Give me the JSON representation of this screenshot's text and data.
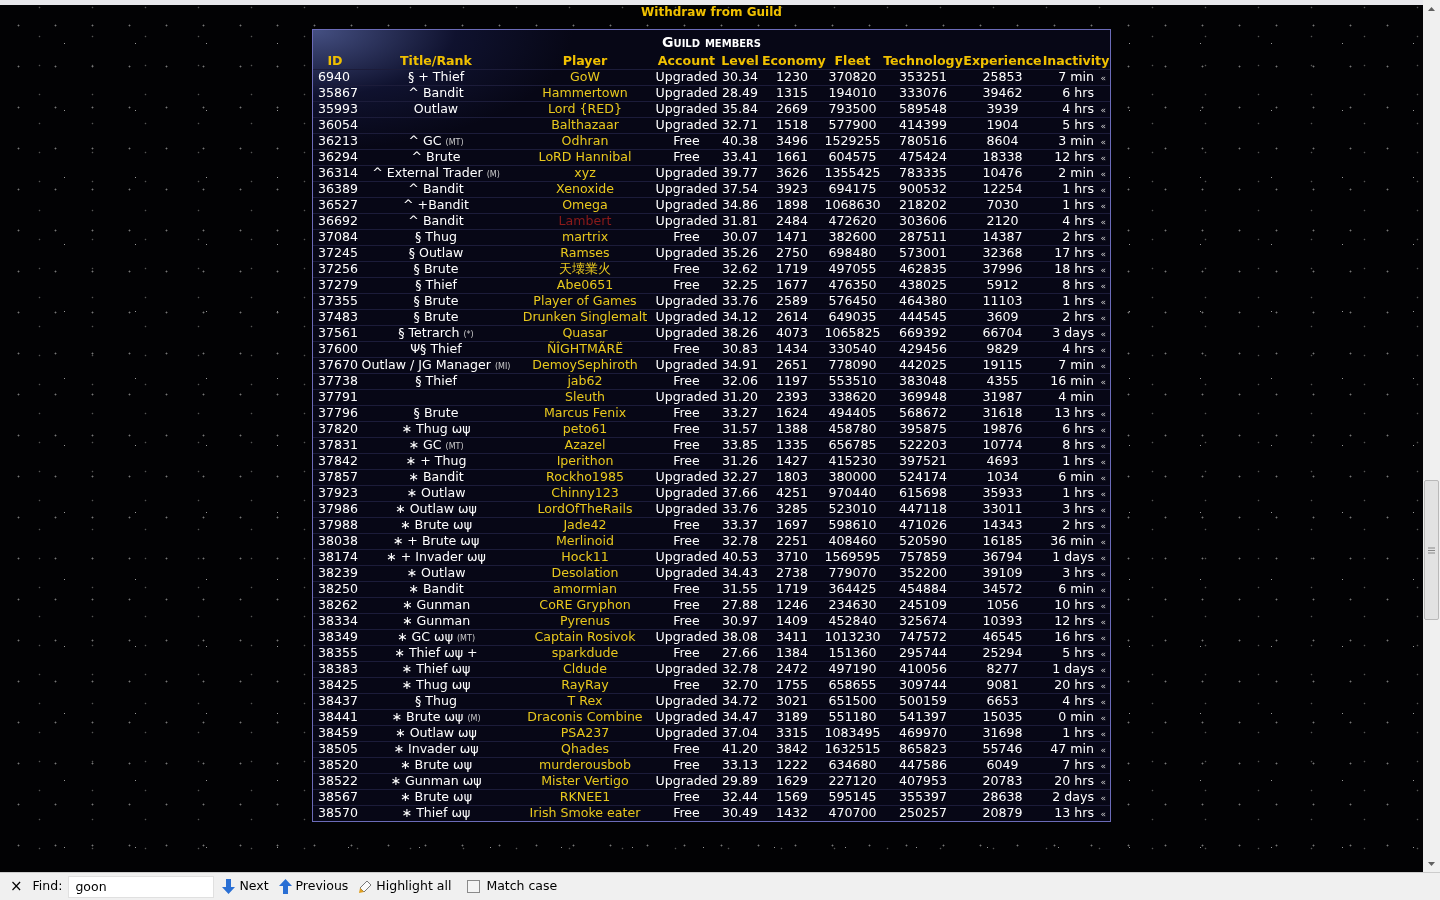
{
  "header_link": "Withdraw from Guild",
  "table": {
    "title": "Guild members",
    "columns": [
      "ID",
      "Title/Rank",
      "Player",
      "Account",
      "Level",
      "Economy",
      "Fleet",
      "Technology",
      "Experience",
      "Inactivity"
    ],
    "rows": [
      {
        "id": "6940",
        "rank": "§ + Thief",
        "player": "GoW",
        "color": "#e8c81e",
        "account": "Upgraded",
        "level": "30.34",
        "economy": "1230",
        "fleet": "370820",
        "technology": "353251",
        "experience": "25853",
        "inactivity": "7 min",
        "mark": "«"
      },
      {
        "id": "35867",
        "rank": "^ Bandit",
        "player": "Hammertown",
        "color": "#e8c81e",
        "account": "Upgraded",
        "level": "28.49",
        "economy": "1315",
        "fleet": "194010",
        "technology": "333076",
        "experience": "39462",
        "inactivity": "6 hrs"
      },
      {
        "id": "35993",
        "rank": "Outlaw",
        "player": "Lord {RED}",
        "color": "#e8c81e",
        "account": "Upgraded",
        "level": "35.84",
        "economy": "2669",
        "fleet": "793500",
        "technology": "589548",
        "experience": "3939",
        "inactivity": "4 hrs",
        "mark": "«"
      },
      {
        "id": "36054",
        "player": "Balthazaar",
        "color": "#e8c81e",
        "account": "Upgraded",
        "level": "32.71",
        "economy": "1518",
        "fleet": "577900",
        "technology": "414399",
        "experience": "1904",
        "inactivity": "5 hrs",
        "mark": "«"
      },
      {
        "id": "36213",
        "rank": "^ GC",
        "tag": "(MT)",
        "player": "Odhran",
        "color": "#e8c81e",
        "account": "Free",
        "level": "40.38",
        "economy": "3496",
        "fleet": "1529255",
        "technology": "780516",
        "experience": "8604",
        "inactivity": "3 min",
        "mark": "«"
      },
      {
        "id": "36294",
        "rank": "^ Brute",
        "player": "LoRD Hannibal",
        "color": "#e8c81e",
        "account": "Free",
        "level": "33.41",
        "economy": "1661",
        "fleet": "604575",
        "technology": "475424",
        "experience": "18338",
        "inactivity": "12 hrs",
        "mark": "«"
      },
      {
        "id": "36314",
        "rank": "^ External Trader",
        "tag": "(M)",
        "player": "xyz",
        "color": "#e8c81e",
        "account": "Upgraded",
        "level": "39.77",
        "economy": "3626",
        "fleet": "1355425",
        "technology": "783335",
        "experience": "10476",
        "inactivity": "2 min",
        "mark": "«"
      },
      {
        "id": "36389",
        "rank": "^ Bandit",
        "player": "Xenoxide",
        "color": "#e8c81e",
        "account": "Upgraded",
        "level": "37.54",
        "economy": "3923",
        "fleet": "694175",
        "technology": "900532",
        "experience": "12254",
        "inactivity": "1 hrs",
        "mark": "«"
      },
      {
        "id": "36527",
        "rank": "^ +Bandit",
        "player": "Omega",
        "color": "#e8c81e",
        "account": "Upgraded",
        "level": "34.86",
        "economy": "1898",
        "fleet": "1068630",
        "technology": "218202",
        "experience": "7030",
        "inactivity": "1 hrs",
        "mark": "«"
      },
      {
        "id": "36692",
        "rank": "^ Bandit",
        "player": "Lambert",
        "color": "#8b1a1a",
        "account": "Upgraded",
        "level": "31.81",
        "economy": "2484",
        "fleet": "472620",
        "technology": "303606",
        "experience": "2120",
        "inactivity": "4 hrs",
        "mark": "«"
      },
      {
        "id": "37084",
        "rank": "§ Thug",
        "player": "martrix",
        "color": "#e8c81e",
        "account": "Free",
        "level": "30.07",
        "economy": "1471",
        "fleet": "382600",
        "technology": "287511",
        "experience": "14387",
        "inactivity": "2 hrs",
        "mark": "«"
      },
      {
        "id": "37245",
        "rank": "§ Outlaw",
        "player": "Ramses",
        "color": "#e8c81e",
        "account": "Upgraded",
        "level": "35.26",
        "economy": "2750",
        "fleet": "698480",
        "technology": "573001",
        "experience": "32368",
        "inactivity": "17 hrs",
        "mark": "«"
      },
      {
        "id": "37256",
        "rank": "§ Brute",
        "player": "天壊業火",
        "color": "#e8c81e",
        "account": "Free",
        "level": "32.62",
        "economy": "1719",
        "fleet": "497055",
        "technology": "462835",
        "experience": "37996",
        "inactivity": "18 hrs",
        "mark": "«"
      },
      {
        "id": "37279",
        "rank": "§ Thief",
        "player": "Abe0651",
        "color": "#e8c81e",
        "account": "Free",
        "level": "32.25",
        "economy": "1677",
        "fleet": "476350",
        "technology": "438025",
        "experience": "5912",
        "inactivity": "8 hrs",
        "mark": "«"
      },
      {
        "id": "37355",
        "rank": "§ Brute",
        "player": "Player of Games",
        "color": "#e8c81e",
        "account": "Upgraded",
        "level": "33.76",
        "economy": "2589",
        "fleet": "576450",
        "technology": "464380",
        "experience": "11103",
        "inactivity": "1 hrs",
        "mark": "«"
      },
      {
        "id": "37483",
        "rank": "§ Brute",
        "player": "Drunken Singlemalt",
        "color": "#e8c81e",
        "account": "Upgraded",
        "level": "34.12",
        "economy": "2614",
        "fleet": "649035",
        "technology": "444545",
        "experience": "3609",
        "inactivity": "2 hrs",
        "mark": "«"
      },
      {
        "id": "37561",
        "rank": "§ Tetrarch",
        "tag": "(*)",
        "player": "Quasar",
        "color": "#e8c81e",
        "account": "Upgraded",
        "level": "38.26",
        "economy": "4073",
        "fleet": "1065825",
        "technology": "669392",
        "experience": "66704",
        "inactivity": "3 days",
        "mark": "«"
      },
      {
        "id": "37600",
        "rank": "Ψ§ Thief",
        "player": "ÑÎGHTMÃRË",
        "color": "#e8c81e",
        "account": "Free",
        "level": "30.83",
        "economy": "1434",
        "fleet": "330540",
        "technology": "429456",
        "experience": "9829",
        "inactivity": "4 hrs",
        "mark": "«"
      },
      {
        "id": "37670",
        "rank": "Outlaw / JG Manager",
        "tag": "(MI)",
        "player": "DemoySephiroth",
        "color": "#e8c81e",
        "account": "Upgraded",
        "level": "34.91",
        "economy": "2651",
        "fleet": "778090",
        "technology": "442025",
        "experience": "19115",
        "inactivity": "7 min",
        "mark": "«"
      },
      {
        "id": "37738",
        "rank": "§ Thief",
        "player": "jab62",
        "color": "#e8c81e",
        "account": "Free",
        "level": "32.06",
        "economy": "1197",
        "fleet": "553510",
        "technology": "383048",
        "experience": "4355",
        "inactivity": "16 min",
        "mark": "«"
      },
      {
        "id": "37791",
        "player": "Sleuth",
        "color": "#e8c81e",
        "account": "Upgraded",
        "level": "31.20",
        "economy": "2393",
        "fleet": "338620",
        "technology": "369948",
        "experience": "31987",
        "inactivity": "4 min"
      },
      {
        "id": "37796",
        "rank": "§ Brute",
        "player": "Marcus Fenix",
        "color": "#e8c81e",
        "account": "Free",
        "level": "33.27",
        "economy": "1624",
        "fleet": "494405",
        "technology": "568672",
        "experience": "31618",
        "inactivity": "13 hrs",
        "mark": "«"
      },
      {
        "id": "37820",
        "rank": "∗ Thug ωψ",
        "player": "peto61",
        "color": "#e8c81e",
        "account": "Free",
        "level": "31.57",
        "economy": "1388",
        "fleet": "458780",
        "technology": "395875",
        "experience": "19876",
        "inactivity": "6 hrs",
        "mark": "«"
      },
      {
        "id": "37831",
        "rank": "∗ GC",
        "tag": "(MT)",
        "player": "Azazel",
        "color": "#e8c81e",
        "account": "Free",
        "level": "33.85",
        "economy": "1335",
        "fleet": "656785",
        "technology": "522203",
        "experience": "10774",
        "inactivity": "8 hrs",
        "mark": "«"
      },
      {
        "id": "37842",
        "rank": "∗ + Thug",
        "player": "Iperithon",
        "color": "#e8c81e",
        "account": "Free",
        "level": "31.26",
        "economy": "1427",
        "fleet": "415230",
        "technology": "397521",
        "experience": "4693",
        "inactivity": "1 hrs",
        "mark": "«"
      },
      {
        "id": "37857",
        "rank": "∗ Bandit",
        "player": "Rockho1985",
        "color": "#e8c81e",
        "account": "Upgraded",
        "level": "32.27",
        "economy": "1803",
        "fleet": "380000",
        "technology": "524174",
        "experience": "1034",
        "inactivity": "6 min",
        "mark": "«"
      },
      {
        "id": "37923",
        "rank": "∗ Outlaw",
        "player": "Chinny123",
        "color": "#e8c81e",
        "account": "Upgraded",
        "level": "37.66",
        "economy": "4251",
        "fleet": "970440",
        "technology": "615698",
        "experience": "35933",
        "inactivity": "1 hrs",
        "mark": "«"
      },
      {
        "id": "37986",
        "rank": "∗ Outlaw ωψ",
        "player": "LordOfTheRails",
        "color": "#e8c81e",
        "account": "Upgraded",
        "level": "33.76",
        "economy": "3285",
        "fleet": "523010",
        "technology": "447118",
        "experience": "33011",
        "inactivity": "3 hrs",
        "mark": "«"
      },
      {
        "id": "37988",
        "rank": "∗ Brute ωψ",
        "player": "Jade42",
        "color": "#e8c81e",
        "account": "Free",
        "level": "33.37",
        "economy": "1697",
        "fleet": "598610",
        "technology": "471026",
        "experience": "14343",
        "inactivity": "2 hrs",
        "mark": "«"
      },
      {
        "id": "38038",
        "rank": "∗ + Brute ωψ",
        "player": "Merlinoid",
        "color": "#e8c81e",
        "account": "Free",
        "level": "32.78",
        "economy": "2251",
        "fleet": "408460",
        "technology": "520590",
        "experience": "16185",
        "inactivity": "36 min",
        "mark": "«"
      },
      {
        "id": "38174",
        "rank": "∗ + Invader ωψ",
        "player": "Hock11",
        "color": "#e8c81e",
        "account": "Upgraded",
        "level": "40.53",
        "economy": "3710",
        "fleet": "1569595",
        "technology": "757859",
        "experience": "36794",
        "inactivity": "1 days",
        "mark": "«"
      },
      {
        "id": "38239",
        "rank": "∗ Outlaw",
        "player": "Desolation",
        "color": "#e8c81e",
        "account": "Upgraded",
        "level": "34.43",
        "economy": "2738",
        "fleet": "779070",
        "technology": "352200",
        "experience": "39109",
        "inactivity": "3 hrs",
        "mark": "«"
      },
      {
        "id": "38250",
        "rank": "∗ Bandit",
        "player": "amormian",
        "color": "#e8c81e",
        "account": "Free",
        "level": "31.55",
        "economy": "1719",
        "fleet": "364425",
        "technology": "454884",
        "experience": "34572",
        "inactivity": "6 min",
        "mark": "«"
      },
      {
        "id": "38262",
        "rank": "∗ Gunman",
        "player": "CoRE Gryphon",
        "color": "#e8c81e",
        "account": "Free",
        "level": "27.88",
        "economy": "1246",
        "fleet": "234630",
        "technology": "245109",
        "experience": "1056",
        "inactivity": "10 hrs",
        "mark": "«"
      },
      {
        "id": "38334",
        "rank": "∗ Gunman",
        "player": "Pyrenus",
        "color": "#e8c81e",
        "account": "Free",
        "level": "30.97",
        "economy": "1409",
        "fleet": "452840",
        "technology": "325674",
        "experience": "10393",
        "inactivity": "12 hrs",
        "mark": "«"
      },
      {
        "id": "38349",
        "rank": "∗ GC ωψ",
        "tag": "(MT)",
        "player": "Captain Rosivok",
        "color": "#e8c81e",
        "account": "Upgraded",
        "level": "38.08",
        "economy": "3411",
        "fleet": "1013230",
        "technology": "747572",
        "experience": "46545",
        "inactivity": "16 hrs",
        "mark": "«"
      },
      {
        "id": "38355",
        "rank": "∗ Thief ωψ +",
        "player": "sparkdude",
        "color": "#e8c81e",
        "account": "Free",
        "level": "27.66",
        "economy": "1384",
        "fleet": "151360",
        "technology": "295744",
        "experience": "25294",
        "inactivity": "5 hrs",
        "mark": "«"
      },
      {
        "id": "38383",
        "rank": "∗ Thief ωψ",
        "player": "Cldude",
        "color": "#e8c81e",
        "account": "Upgraded",
        "level": "32.78",
        "economy": "2472",
        "fleet": "497190",
        "technology": "410056",
        "experience": "8277",
        "inactivity": "1 days",
        "mark": "«"
      },
      {
        "id": "38425",
        "rank": "∗ Thug ωψ",
        "player": "RayRay",
        "color": "#e8c81e",
        "account": "Free",
        "level": "32.70",
        "economy": "1755",
        "fleet": "658655",
        "technology": "309744",
        "experience": "9081",
        "inactivity": "20 hrs",
        "mark": "«"
      },
      {
        "id": "38437",
        "rank": "§ Thug",
        "player": "T Rex",
        "color": "#e8c81e",
        "account": "Upgraded",
        "level": "34.72",
        "economy": "3021",
        "fleet": "651500",
        "technology": "500159",
        "experience": "6653",
        "inactivity": "4 hrs",
        "mark": "«"
      },
      {
        "id": "38441",
        "rank": "∗ Brute ωψ",
        "tag": "(M)",
        "player": "Draconis Combine",
        "color": "#e8c81e",
        "account": "Upgraded",
        "level": "34.47",
        "economy": "3189",
        "fleet": "551180",
        "technology": "541397",
        "experience": "15035",
        "inactivity": "0 min",
        "mark": "«"
      },
      {
        "id": "38459",
        "rank": "∗ Outlaw ωψ",
        "player": "PSA237",
        "color": "#e8c81e",
        "account": "Upgraded",
        "level": "37.04",
        "economy": "3315",
        "fleet": "1083495",
        "technology": "469970",
        "experience": "31698",
        "inactivity": "1 hrs",
        "mark": "«"
      },
      {
        "id": "38505",
        "rank": "∗ Invader ωψ",
        "player": "Qhades",
        "color": "#e8c81e",
        "account": "Free",
        "level": "41.20",
        "economy": "3842",
        "fleet": "1632515",
        "technology": "865823",
        "experience": "55746",
        "inactivity": "47 min",
        "mark": "«"
      },
      {
        "id": "38520",
        "rank": "∗ Brute ωψ",
        "player": "murderousbob",
        "color": "#e8c81e",
        "account": "Free",
        "level": "33.13",
        "economy": "1222",
        "fleet": "634680",
        "technology": "447586",
        "experience": "6049",
        "inactivity": "7 hrs",
        "mark": "«"
      },
      {
        "id": "38522",
        "rank": "∗ Gunman ωψ",
        "player": "Mister Vertigo",
        "color": "#e8c81e",
        "account": "Upgraded",
        "level": "29.89",
        "economy": "1629",
        "fleet": "227120",
        "technology": "407953",
        "experience": "20783",
        "inactivity": "20 hrs",
        "mark": "«"
      },
      {
        "id": "38567",
        "rank": "∗ Brute ωψ",
        "player": "RKNEE1",
        "color": "#e8c81e",
        "account": "Free",
        "level": "32.44",
        "economy": "1569",
        "fleet": "595145",
        "technology": "355397",
        "experience": "28638",
        "inactivity": "2 days",
        "mark": "«"
      },
      {
        "id": "38570",
        "rank": "∗ Thief ωψ",
        "player": "Irish Smoke eater",
        "color": "#e8c81e",
        "account": "Free",
        "level": "30.49",
        "economy": "1432",
        "fleet": "470700",
        "technology": "250257",
        "experience": "20879",
        "inactivity": "13 hrs",
        "mark": "«"
      }
    ]
  },
  "find_bar": {
    "close": "×",
    "label": "Find:",
    "value": "goon",
    "next": "Next",
    "previous": "Previous",
    "highlight": "Highlight all",
    "match_case": {
      "label": "Match case",
      "checked": false
    }
  }
}
